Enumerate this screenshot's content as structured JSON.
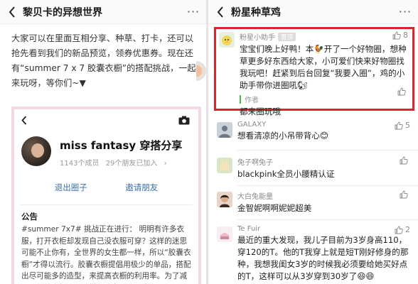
{
  "left": {
    "title": "黎贝卡的异想世界",
    "more": "···",
    "intro": "大家可以在里面互相分享、种草、打卡，还可以抢先看到我们的新品预览，领券优惠券。现在还有“summer 7 x 7 胶囊衣橱”的搭配挑战，一起来玩呀，等你们~▼",
    "card": {
      "group_name": "miss fantasy 穿搭分享",
      "members": "1143个成员",
      "friends": "29个朋友已加入",
      "friends_arrow": "›",
      "exit_label": "退出圈子",
      "invite_label": "邀请朋友",
      "notice_title": "公告",
      "notice_text": "#summer 7x7# 挑战正在进行： 明明有许多衣服，打开衣柜却发现自己没衣服可穿？这样的迷思可能不止你有，全世界的女生都一样，所以“胶囊衣橱”才得以流行。胶囊衣橱提倡用极少的单品，搭配出尽可能多的造型，来提高衣橱的利用率。为了减少无用的身相，考验搭配功力，我们发起"
    }
  },
  "right": {
    "title": "粉星种草鸡",
    "more": "···",
    "highlight": {
      "name": "粉星小助手",
      "tag": "置顶",
      "likes": "8",
      "text": "宝宝们晚上好鸭！本🐓开了一个好物圈，想种草更多好东西给大家，小可爱们快来好物圈找我玩吧！赶紧到后台回复“我要入圈”，鸡的小助手带你进圈吼🐿",
      "author_label": "作者",
      "author_reply": "都来圈玩哦"
    },
    "comments": [
      {
        "name": "GALAXY",
        "text": "想看清凉的小吊带背心😊",
        "likes": "5"
      },
      {
        "name": "兔子啊兔子",
        "text": "blackpink全员小腰精认证",
        "likes": ""
      },
      {
        "name": "大白兔能量",
        "text": "金智妮啊啊妮妮超美",
        "likes": ""
      },
      {
        "name": "Te Fuir",
        "text": "最近的重大发现，我儿子目前为3岁身高110，穿120的T。他的T我穿上就是短T刚好修身的那种，我想我闺女3岁的时候我必须要给她买好点的T，这样可以从3岁穿到30岁了😆😆",
        "likes": "2"
      }
    ]
  },
  "colors": {
    "highlight_border": "#d9262c",
    "card_border": "#f3d9e2",
    "link_blue": "#3b6ea8",
    "author_green": "#4cbb4c"
  }
}
